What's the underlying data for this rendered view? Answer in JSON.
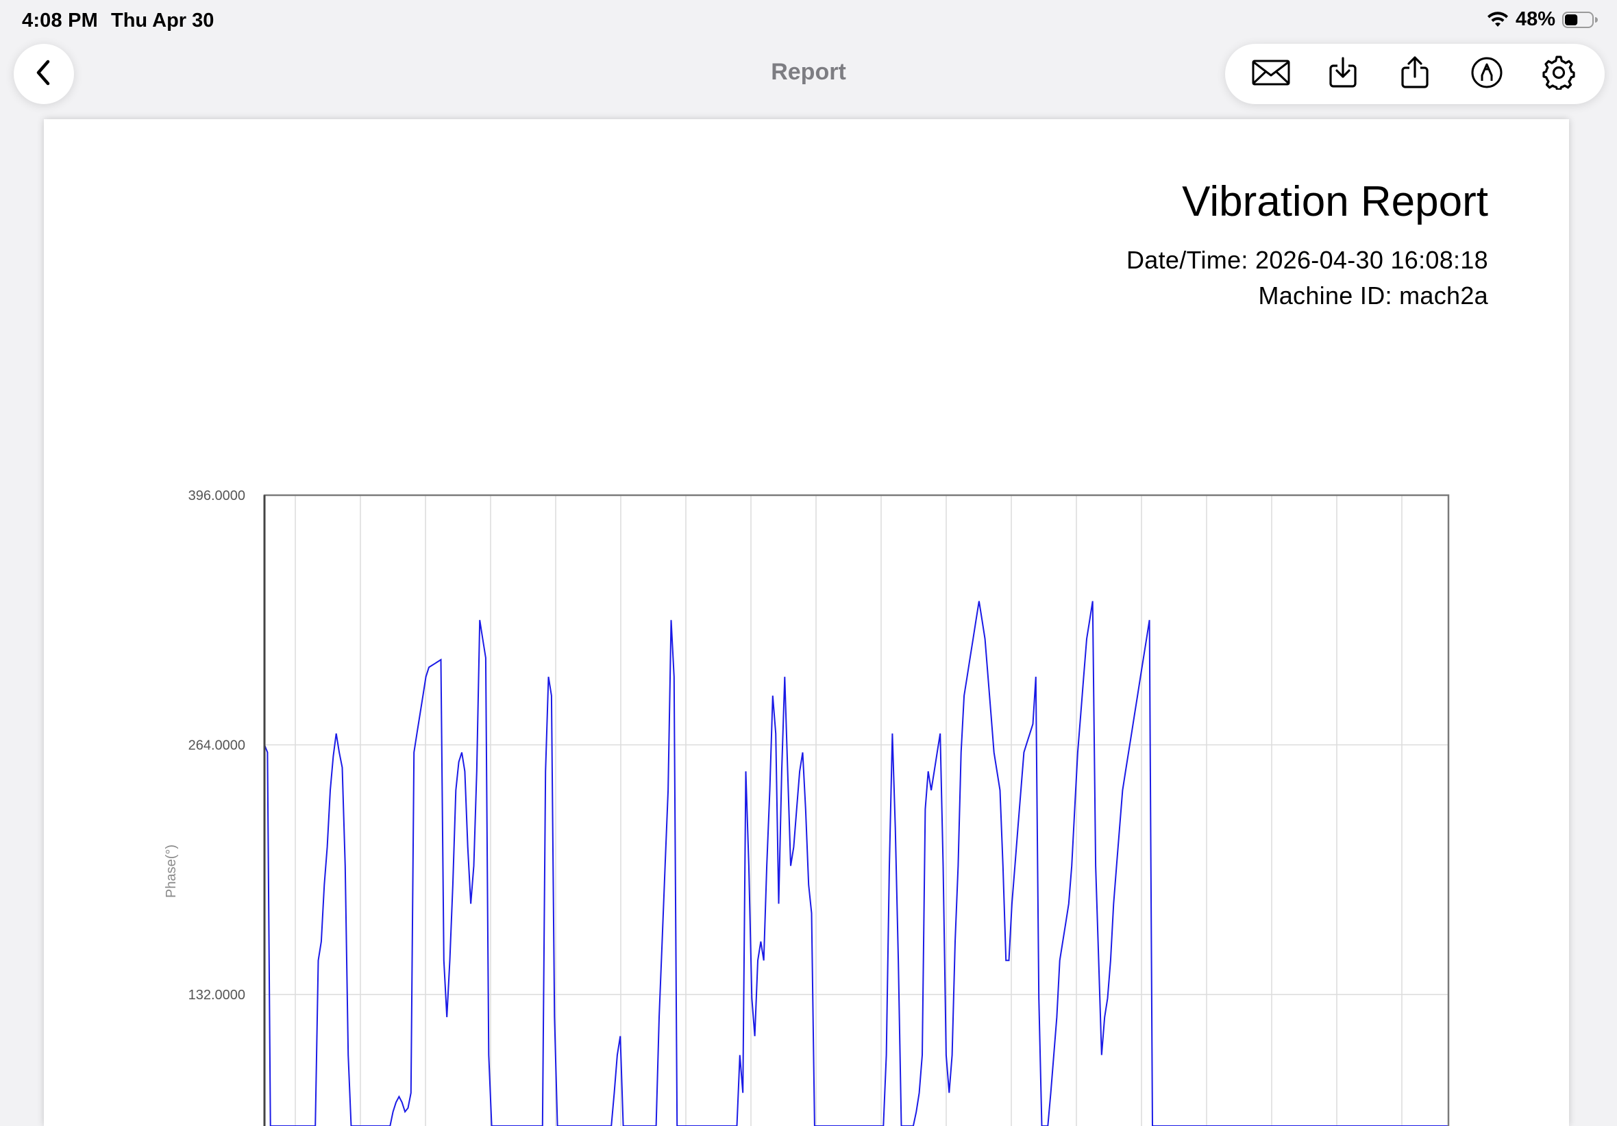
{
  "status": {
    "time": "4:08 PM",
    "date": "Thu Apr 30",
    "battery": "48%",
    "battery_level": 0.48
  },
  "nav": {
    "title": "Report",
    "back_icon": "chevron-left-icon",
    "toolbar": [
      "envelope-icon",
      "download-icon",
      "share-icon",
      "markup-icon",
      "gear-icon"
    ]
  },
  "report": {
    "title": "Vibration Report",
    "datetime": "Date/Time: 2026-04-30 16:08:18",
    "machine": "Machine ID: mach2a"
  },
  "chart_data": {
    "type": "line",
    "ylabel": "Phase(°)",
    "ylim": [
      0,
      396
    ],
    "yticks": [
      "396.0000",
      "264.0000",
      "132.0000"
    ],
    "grid": true,
    "color": "#1a1ae6",
    "values": [
      264,
      260,
      0,
      0,
      0,
      0,
      0,
      0,
      0,
      0,
      0,
      0,
      0,
      0,
      0,
      0,
      0,
      0,
      150,
      160,
      190,
      210,
      240,
      258,
      270,
      260,
      252,
      200,
      100,
      0,
      0,
      0,
      0,
      0,
      0,
      0,
      0,
      0,
      0,
      0,
      0,
      0,
      60,
      70,
      75,
      78,
      75,
      70,
      72,
      80,
      260,
      270,
      280,
      290,
      300,
      305,
      306,
      307,
      308,
      309,
      150,
      120,
      150,
      190,
      240,
      255,
      260,
      250,
      210,
      180,
      200,
      250,
      330,
      320,
      310,
      100,
      0,
      0,
      0,
      0,
      0,
      0,
      0,
      0,
      0,
      0,
      0,
      0,
      0,
      0,
      0,
      0,
      0,
      40,
      250,
      300,
      290,
      120,
      0,
      0,
      0,
      0,
      0,
      0,
      0,
      0,
      0,
      0,
      0,
      0,
      0,
      0,
      0,
      0,
      0,
      0,
      60,
      80,
      100,
      110,
      0,
      0,
      0,
      0,
      0,
      0,
      0,
      0,
      0,
      0,
      60,
      0,
      120,
      160,
      200,
      240,
      330,
      300,
      0,
      0,
      0,
      0,
      0,
      0,
      0,
      0,
      0,
      0,
      0,
      0,
      0,
      0,
      0,
      0,
      0,
      0,
      0,
      0,
      60,
      100,
      80,
      250,
      200,
      130,
      110,
      150,
      160,
      150,
      200,
      240,
      290,
      270,
      180,
      250,
      300,
      250,
      200,
      210,
      230,
      250,
      260,
      230,
      190,
      175,
      0,
      0,
      0,
      0,
      0,
      0,
      0,
      0,
      0,
      0,
      0,
      0,
      0,
      0,
      0,
      0,
      0,
      0,
      0,
      0,
      0,
      0,
      60,
      0,
      100,
      200,
      270,
      220,
      150,
      0,
      20,
      30,
      50,
      60,
      70,
      80,
      100,
      230,
      250,
      240,
      250,
      260,
      270,
      200,
      100,
      80,
      100,
      160,
      200,
      260,
      290,
      300,
      310,
      320,
      330,
      340,
      330,
      320,
      300,
      280,
      260,
      250,
      240,
      200,
      150,
      150,
      180,
      200,
      220,
      240,
      260,
      265,
      270,
      275,
      300,
      130,
      0,
      0,
      50,
      80,
      100,
      120,
      150,
      160,
      170,
      180,
      200,
      230,
      260,
      280,
      300,
      320,
      330,
      340,
      200,
      150,
      100,
      120,
      130,
      150,
      180,
      200,
      220,
      240,
      250,
      260,
      270,
      280,
      290,
      300,
      310,
      320,
      330,
      0,
      0,
      0,
      0,
      0,
      0,
      0,
      0,
      0,
      0,
      0,
      0,
      0,
      0,
      0,
      0,
      0,
      0,
      0,
      0,
      0,
      0,
      0,
      0,
      0,
      0,
      0,
      0,
      0,
      0,
      0,
      0,
      0,
      0,
      0,
      0,
      0,
      0,
      0,
      0,
      0,
      0,
      0,
      0,
      0,
      0,
      0,
      0,
      0,
      0,
      0,
      0,
      0,
      0,
      0,
      0,
      0,
      0,
      0,
      0,
      0,
      0,
      0,
      0,
      0,
      0,
      0,
      0,
      0,
      0,
      0,
      0,
      0,
      0,
      0,
      0,
      0,
      0,
      0,
      0,
      0,
      0,
      0,
      0,
      0,
      0,
      0,
      0,
      0,
      0,
      0,
      0,
      0,
      0,
      0,
      0,
      0,
      0,
      0,
      0
    ]
  }
}
